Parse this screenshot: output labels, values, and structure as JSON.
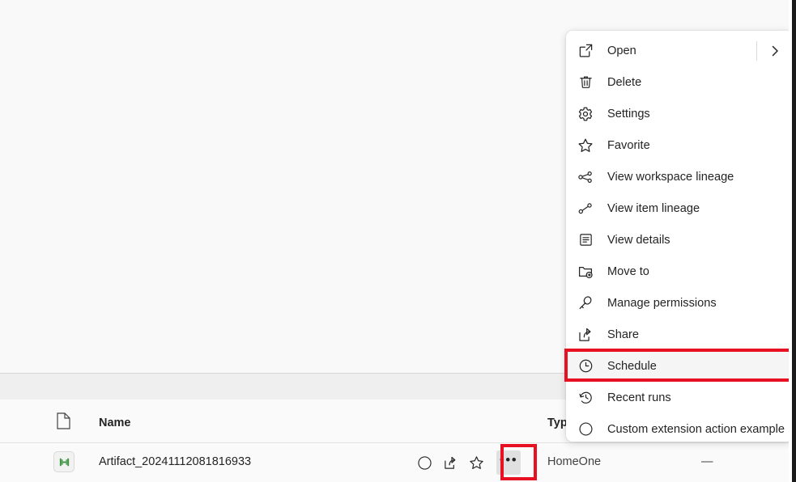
{
  "page": {
    "background_color": "#fafafa",
    "toolbar_band_color": "#efefef",
    "accent_highlight_color": "#e81123"
  },
  "list": {
    "columns": [
      {
        "key": "icon",
        "label": "",
        "icon": "document-icon"
      },
      {
        "key": "name",
        "label": "Name"
      },
      {
        "key": "type",
        "label": "Typ"
      }
    ],
    "rows": [
      {
        "icon": "dataflow-green-icon",
        "name": "Artifact_20241112081816933",
        "type": "HomeOne",
        "extra": "—",
        "actions": [
          {
            "name": "circle-icon",
            "label": ""
          },
          {
            "name": "share-icon",
            "label": ""
          },
          {
            "name": "star-icon",
            "label": ""
          },
          {
            "name": "more-options-icon",
            "label": "•••"
          }
        ]
      }
    ]
  },
  "context_menu": {
    "items": [
      {
        "id": "open",
        "label": "Open",
        "icon": "open-external-icon",
        "has_submenu": true,
        "highlighted": false
      },
      {
        "id": "delete",
        "label": "Delete",
        "icon": "trash-icon",
        "has_submenu": false,
        "highlighted": false
      },
      {
        "id": "settings",
        "label": "Settings",
        "icon": "gear-icon",
        "has_submenu": false,
        "highlighted": false
      },
      {
        "id": "favorite",
        "label": "Favorite",
        "icon": "star-icon",
        "has_submenu": false,
        "highlighted": false
      },
      {
        "id": "view-workspace-lineage",
        "label": "View workspace lineage",
        "icon": "workspace-lineage-icon",
        "has_submenu": false,
        "highlighted": false
      },
      {
        "id": "view-item-lineage",
        "label": "View item lineage",
        "icon": "item-lineage-icon",
        "has_submenu": false,
        "highlighted": false
      },
      {
        "id": "view-details",
        "label": "View details",
        "icon": "details-icon",
        "has_submenu": false,
        "highlighted": false
      },
      {
        "id": "move-to",
        "label": "Move to",
        "icon": "move-folder-icon",
        "has_submenu": false,
        "highlighted": false
      },
      {
        "id": "manage-permissions",
        "label": "Manage permissions",
        "icon": "key-icon",
        "has_submenu": false,
        "highlighted": false
      },
      {
        "id": "share",
        "label": "Share",
        "icon": "share-icon",
        "has_submenu": false,
        "highlighted": false
      },
      {
        "id": "schedule",
        "label": "Schedule",
        "icon": "clock-icon",
        "has_submenu": false,
        "highlighted": true
      },
      {
        "id": "recent-runs",
        "label": "Recent runs",
        "icon": "history-icon",
        "has_submenu": false,
        "highlighted": false
      },
      {
        "id": "custom-extension-action-example",
        "label": "Custom extension action example",
        "icon": "circle-icon",
        "has_submenu": false,
        "highlighted": false
      }
    ]
  },
  "annotations": [
    {
      "name": "more-options-highlight",
      "target": "more-options-icon",
      "color": "#e81123"
    },
    {
      "name": "schedule-menu-item-highlight",
      "target": "schedule",
      "color": "#e81123"
    }
  ]
}
